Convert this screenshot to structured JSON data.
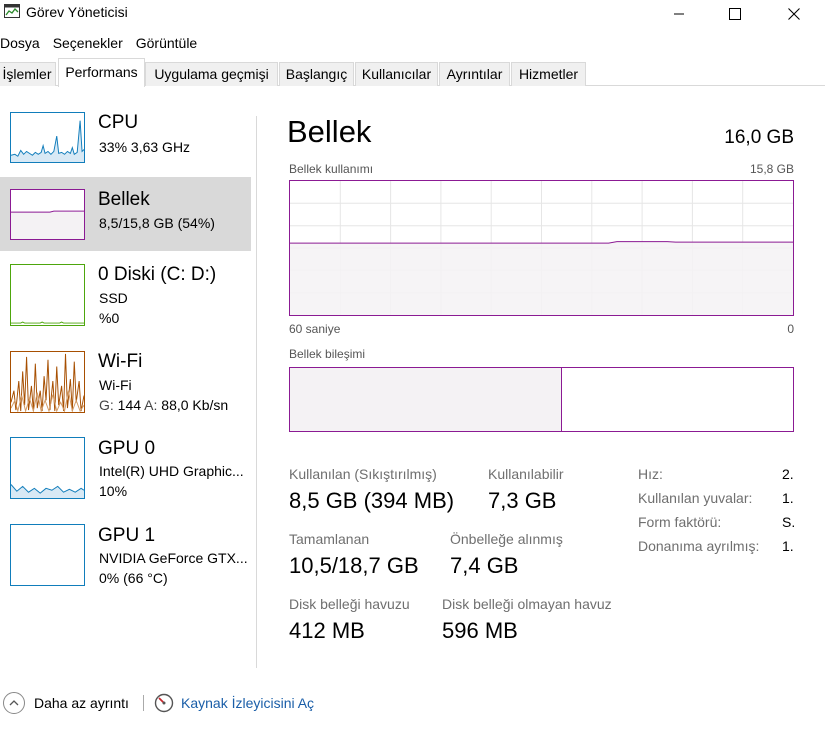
{
  "window": {
    "title": "Görev Yöneticisi",
    "icon": "task-manager-icon",
    "buttons": [
      "minimize-icon",
      "maximize-icon",
      "close-icon"
    ]
  },
  "menu": [
    "Dosya",
    "Seçenekler",
    "Görüntüle"
  ],
  "tabs": [
    {
      "label": "İşlemler",
      "active": false
    },
    {
      "label": "Performans",
      "active": true
    },
    {
      "label": "Uygulama geçmişi",
      "active": false
    },
    {
      "label": "Başlangıç",
      "active": false
    },
    {
      "label": "Kullanıcılar",
      "active": false
    },
    {
      "label": "Ayrıntılar",
      "active": false
    },
    {
      "label": "Hizmetler",
      "active": false
    }
  ],
  "sidebar": {
    "items": [
      {
        "title": "CPU",
        "line1": "33% 3,63 GHz",
        "color": "#117dbb",
        "selected": false
      },
      {
        "title": "Bellek",
        "line1": "8,5/15,8 GB (54%)",
        "color": "#8b1a93",
        "selected": true
      },
      {
        "title": "0 Diski (C: D:)",
        "line1": "SSD",
        "line2": "%0",
        "color": "#4da60c",
        "selected": false
      },
      {
        "title": "Wi-Fi",
        "line1": "Wi-Fi",
        "line2_send_label": "G:",
        "line2_send": "144",
        "line2_recv_label": "A:",
        "line2_recv": "88,0 Kb/sn",
        "color": "#a74f01",
        "selected": false
      },
      {
        "title": "GPU 0",
        "line1": "Intel(R) UHD Graphic...",
        "line2": "10%",
        "color": "#117dbb",
        "selected": false
      },
      {
        "title": "GPU 1",
        "line1": "NVIDIA GeForce GTX...",
        "line2": "0% (66 °C)",
        "color": "#117dbb",
        "selected": false
      }
    ]
  },
  "main": {
    "title": "Bellek",
    "total": "16,0 GB",
    "usage_chart": {
      "label": "Bellek kullanımı",
      "max_label": "15,8 GB",
      "time_left": "60 saniye",
      "time_right": "0",
      "usage_fraction": 0.54
    },
    "composition": {
      "label": "Bellek bileşimi",
      "used_fraction": 0.54
    },
    "stats": {
      "in_use_label": "Kullanılan (Sıkıştırılmış)",
      "in_use_value": "8,5 GB (394 MB)",
      "available_label": "Kullanılabilir",
      "available_value": "7,3 GB",
      "committed_label": "Tamamlanan",
      "committed_value": "10,5/18,7 GB",
      "cached_label": "Önbelleğe alınmış",
      "cached_value": "7,4 GB",
      "paged_label": "Disk belleği havuzu",
      "paged_value": "412 MB",
      "nonpaged_label": "Disk belleği olmayan havuz",
      "nonpaged_value": "596 MB"
    },
    "properties": [
      {
        "label": "Hız:",
        "value": "2."
      },
      {
        "label": "Kullanılan yuvalar:",
        "value": "1."
      },
      {
        "label": "Form faktörü:",
        "value": "S."
      },
      {
        "label": "Donanıma ayrılmış:",
        "value": "1."
      }
    ]
  },
  "footer": {
    "fewer_details": "Daha az ayrıntı",
    "resource_monitor": "Kaynak İzleyicisini Aç"
  }
}
